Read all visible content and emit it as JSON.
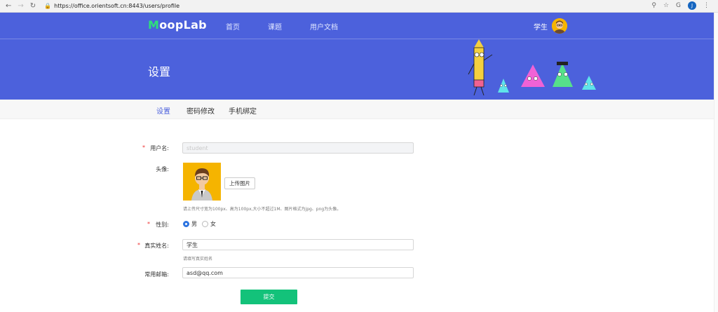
{
  "browser": {
    "url": "https://office.orientsoft.cn:8443/users/profile",
    "profile_initial": "J"
  },
  "header": {
    "logo_first": "M",
    "logo_rest": "oopLab",
    "menu": [
      "首页",
      "课题",
      "用户文档"
    ],
    "user_name": "学生"
  },
  "banner": {
    "title": "设置"
  },
  "tabs": [
    {
      "label": "设置",
      "active": true
    },
    {
      "label": "密码修改",
      "active": false
    },
    {
      "label": "手机绑定",
      "active": false
    }
  ],
  "form": {
    "username": {
      "label": "用户名:",
      "value": "student",
      "required": true
    },
    "avatar": {
      "label": "头像:",
      "upload_label": "上传图片",
      "hint": "请上传尺寸宽为100px、高为100px,大小不超过1M、图片格式为jpg、png为头像。"
    },
    "gender": {
      "label": "性别:",
      "options": [
        "男",
        "女"
      ],
      "selected": "男",
      "required": true
    },
    "real_name": {
      "label": "真实姓名:",
      "value": "学生",
      "hint": "请填写真实姓名",
      "required": true
    },
    "email": {
      "label": "常用邮箱:",
      "value": "asd@qq.com"
    },
    "submit_label": "提交"
  },
  "colors": {
    "brand": "#4c61dc",
    "logo_accent": "#2ee07a",
    "submit": "#13c27a",
    "active_tab": "#4c61dc"
  }
}
